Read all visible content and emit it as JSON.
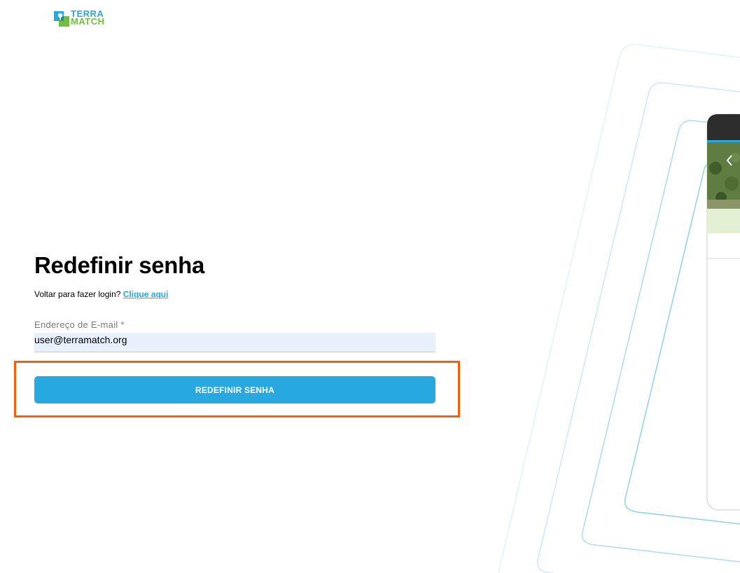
{
  "logo": {
    "line1": "TERRA",
    "line2": "MATCH",
    "colors": {
      "blue": "#27a9e0",
      "green": "#72bf44"
    }
  },
  "form": {
    "title": "Redefinir senha",
    "back_prompt": "Voltar para fazer login?",
    "back_link": "Clique aqui",
    "email_label": "Endereço de E-mail *",
    "email_value": "user@terramatch.org",
    "submit_label": "REDEFINIR SENHA"
  },
  "colors": {
    "accent": "#27a9e0",
    "highlight": "#f2600c",
    "input_bg": "#e8f0fe"
  },
  "preview": {
    "nav_icon": "chevron-left-icon"
  }
}
